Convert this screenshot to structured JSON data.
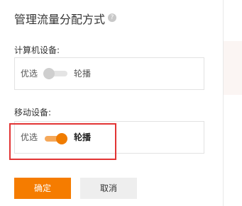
{
  "dialog": {
    "title": "管理流量分配方式",
    "help_icon_glyph": "?"
  },
  "sections": [
    {
      "label": "计算机设备:",
      "option_left": "优选",
      "option_right": "轮播",
      "toggle_state": "off"
    },
    {
      "label": "移动设备:",
      "option_left": "优选",
      "option_right": "轮播",
      "toggle_state": "on"
    }
  ],
  "buttons": {
    "confirm": "确定",
    "cancel": "取消"
  },
  "colors": {
    "accent": "#f57c00",
    "toggle_on_track": "#f5a85a",
    "toggle_off_track": "#e4e4e4",
    "highlight_box": "#e23434"
  }
}
